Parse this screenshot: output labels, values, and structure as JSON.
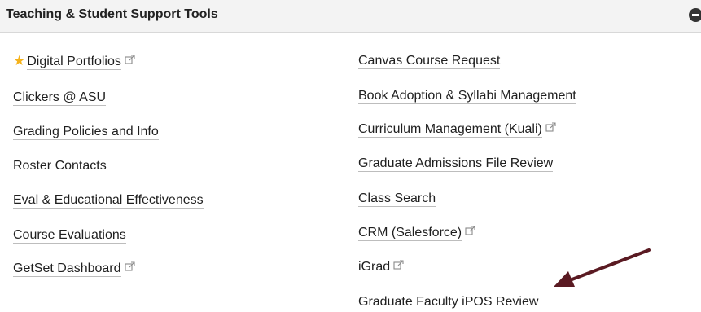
{
  "panel": {
    "title": "Teaching & Student Support Tools",
    "collapse_icon": "minus-circle-icon"
  },
  "left_column": [
    {
      "label": "Digital Portfolios",
      "starred": true,
      "external": true
    },
    {
      "label": "Clickers @ ASU",
      "external": false
    },
    {
      "label": "Grading Policies and Info",
      "external": false
    },
    {
      "label": "Roster Contacts",
      "external": false
    },
    {
      "label": "Eval & Educational Effectiveness",
      "external": false
    },
    {
      "label": "Course Evaluations",
      "external": false
    },
    {
      "label": "GetSet Dashboard",
      "external": true
    }
  ],
  "right_column": [
    {
      "label": "Canvas Course Request",
      "external": false
    },
    {
      "label": "Book Adoption & Syllabi Management",
      "external": false
    },
    {
      "label": "Curriculum Management (Kuali)",
      "external": true
    },
    {
      "label": "Graduate Admissions File Review",
      "external": false
    },
    {
      "label": "Class Search",
      "external": false
    },
    {
      "label": "CRM (Salesforce)",
      "external": true
    },
    {
      "label": "iGrad",
      "external": true
    },
    {
      "label": "Graduate Faculty iPOS Review",
      "external": false
    }
  ],
  "colors": {
    "star": "#f5b21b",
    "arrow": "#5a1a22",
    "header_bg": "#f3f3f3"
  },
  "icons": {
    "star": "star-icon",
    "external": "external-link-icon",
    "annotation": "arrow-pointer-icon"
  }
}
